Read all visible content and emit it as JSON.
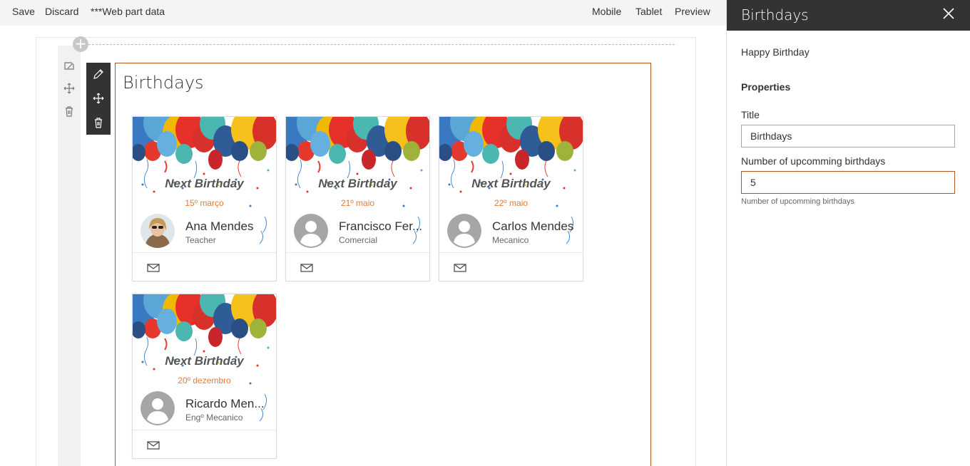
{
  "toolbar": {
    "save": "Save",
    "discard": "Discard",
    "webpart_data": "***Web part data",
    "mobile": "Mobile",
    "tablet": "Tablet",
    "preview": "Preview"
  },
  "webpart": {
    "title": "Birthdays",
    "cards": [
      {
        "heading": "Next Birthday",
        "date": "15º março",
        "name": "Ana Mendes",
        "job": "Teacher",
        "avatar": "photo"
      },
      {
        "heading": "Next Birthday",
        "date": "21º maio",
        "name": "Francisco Fer...",
        "job": "Comercial",
        "avatar": "placeholder"
      },
      {
        "heading": "Next Birthday",
        "date": "22º maio",
        "name": "Carlos Mendes",
        "job": "Mecanico",
        "avatar": "placeholder"
      },
      {
        "heading": "Next Birthday",
        "date": "20º dezembro",
        "name": "Ricardo Men...",
        "job": "Engº Mecanico",
        "avatar": "placeholder"
      }
    ]
  },
  "panel": {
    "title": "Birthdays",
    "description": "Happy Birthday",
    "group_label": "Properties",
    "title_field_label": "Title",
    "title_field_value": "Birthdays",
    "count_field_label": "Number of upcomming birthdays",
    "count_field_value": "5",
    "count_field_help": "Number of upcomming birthdays"
  },
  "colors": {
    "accent": "#b05a22",
    "date": "#e07b39",
    "panel_header": "#333333",
    "toolbar_bg": "#f4f4f4"
  },
  "icons": [
    "edit-icon",
    "move-icon",
    "delete-icon",
    "mail-icon",
    "close-icon",
    "add-section-icon"
  ]
}
